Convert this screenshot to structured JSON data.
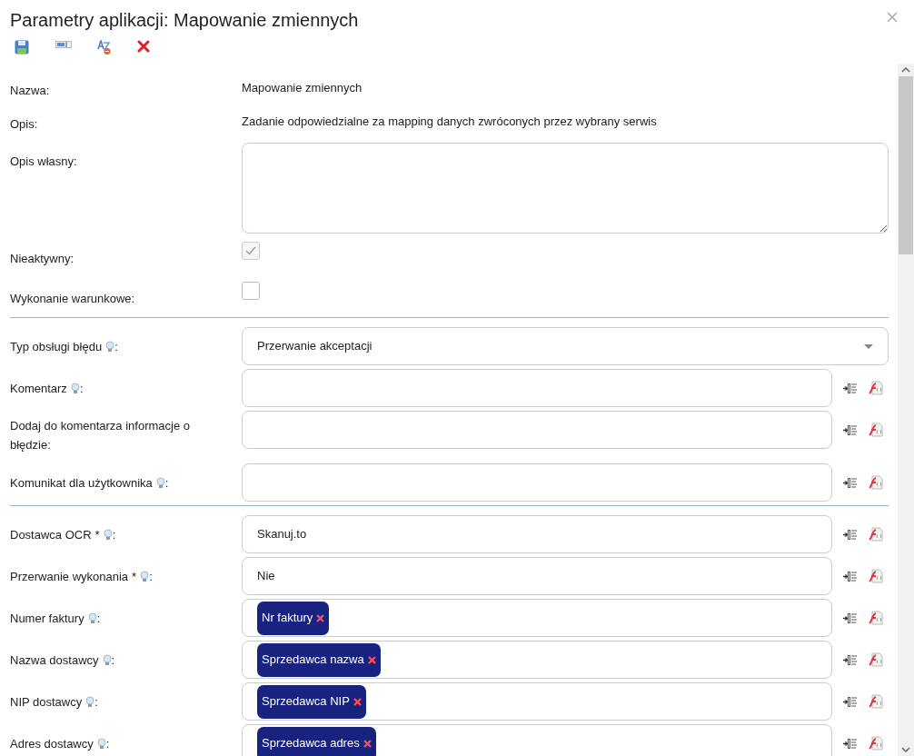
{
  "dialog": {
    "title": "Parametry aplikacji: Mapowanie zmiennych"
  },
  "toolbar": [
    {
      "kind": "save"
    },
    {
      "kind": "field"
    },
    {
      "kind": "translate"
    },
    {
      "kind": "delete"
    }
  ],
  "rows": [
    {
      "kind": "text",
      "label": "Nazwa:",
      "value": "Mapowanie zmiennych"
    },
    {
      "kind": "text",
      "label": "Opis:",
      "value": "Zadanie odpowiedzialne za mapping danych zwróconych przez wybrany serwis"
    },
    {
      "kind": "textarea",
      "label": "Opis własny:"
    },
    {
      "kind": "checkbox",
      "label": "Nieaktywny:",
      "checked": true,
      "disabled": true
    },
    {
      "kind": "checkbox",
      "label": "Wykonanie warunkowe:",
      "checked": false,
      "disabled": false
    },
    {
      "kind": "divider"
    },
    {
      "kind": "select",
      "label": "Typ obsługi błędu",
      "hint": true,
      "label_end": ":",
      "value": "Przerwanie akceptacji"
    },
    {
      "kind": "input",
      "label": "Komentarz",
      "hint": true,
      "label_end": ":"
    },
    {
      "kind": "input",
      "label": "Dodaj do komentarza informacje o błędzie:",
      "hint": false
    },
    {
      "kind": "input",
      "label": "Komunikat dla użytkownika",
      "hint": true,
      "label_end": ":"
    },
    {
      "kind": "divider"
    },
    {
      "kind": "input",
      "label": "Dostawca OCR",
      "required_mark": "*",
      "hint": true,
      "label_end": ":",
      "value": "Skanuj.to"
    },
    {
      "kind": "input",
      "label": "Przerwanie wykonania",
      "required_mark": "*",
      "hint": true,
      "label_end": ":",
      "value": "Nie"
    },
    {
      "kind": "input",
      "label": "Numer faktury",
      "hint": true,
      "label_end": ":",
      "tags": [
        "Nr faktury"
      ]
    },
    {
      "kind": "input",
      "label": "Nazwa dostawcy",
      "hint": true,
      "label_end": ":",
      "tags": [
        "Sprzedawca nazwa"
      ]
    },
    {
      "kind": "input",
      "label": "NIP dostawcy",
      "hint": true,
      "label_end": ":",
      "tags": [
        "Sprzedawca NIP"
      ]
    },
    {
      "kind": "input",
      "label": "Adres dostawcy",
      "hint": true,
      "label_end": ":",
      "tags": [
        "Sprzedawca adres"
      ]
    }
  ]
}
